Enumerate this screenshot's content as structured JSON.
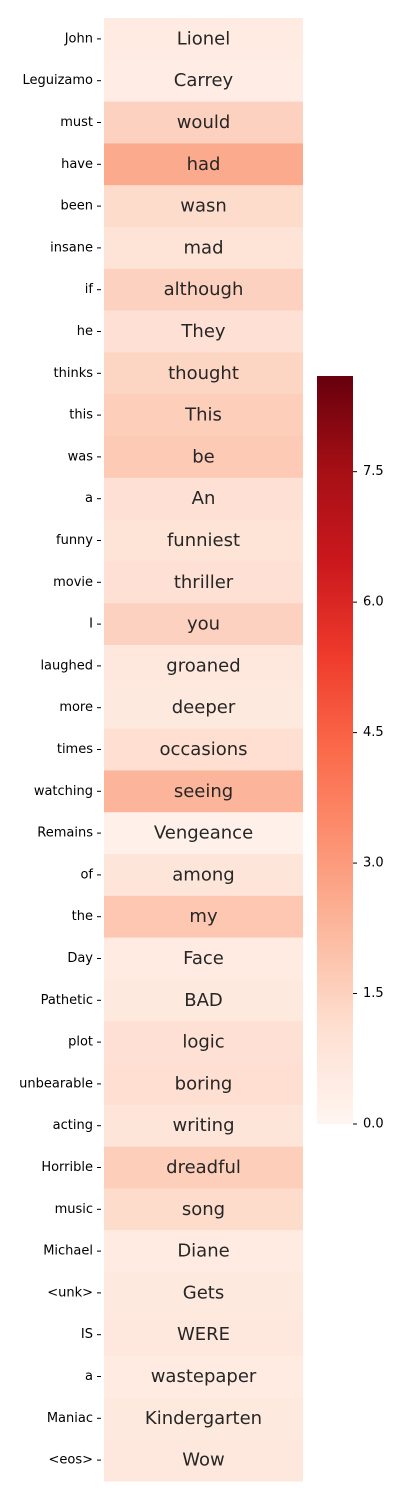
{
  "chart_data": {
    "type": "heatmap",
    "colormap": "Reds",
    "vmin": 0,
    "vmax": 8.6,
    "colorbar_ticks": [
      "0.0",
      "1.5",
      "3.0",
      "4.5",
      "6.0",
      "7.5"
    ],
    "rows": [
      {
        "label": "John",
        "cell": "Lionel",
        "value": 0.5
      },
      {
        "label": "Leguizamo",
        "cell": "Carrey",
        "value": 0.4
      },
      {
        "label": "must",
        "cell": "would",
        "value": 1.5
      },
      {
        "label": "have",
        "cell": "had",
        "value": 2.6
      },
      {
        "label": "been",
        "cell": "wasn",
        "value": 1.2
      },
      {
        "label": "insane",
        "cell": "mad",
        "value": 0.9
      },
      {
        "label": "if",
        "cell": "although",
        "value": 1.5
      },
      {
        "label": "he",
        "cell": "They",
        "value": 1.0
      },
      {
        "label": "thinks",
        "cell": "thought",
        "value": 1.4
      },
      {
        "label": "this",
        "cell": "This",
        "value": 1.6
      },
      {
        "label": "was",
        "cell": "be",
        "value": 1.7
      },
      {
        "label": "a",
        "cell": "An",
        "value": 1.0
      },
      {
        "label": "funny",
        "cell": "funniest",
        "value": 0.9
      },
      {
        "label": "movie",
        "cell": "thriller",
        "value": 1.0
      },
      {
        "label": "I",
        "cell": "you",
        "value": 1.5
      },
      {
        "label": "laughed",
        "cell": "groaned",
        "value": 0.7
      },
      {
        "label": "more",
        "cell": "deeper",
        "value": 0.6
      },
      {
        "label": "times",
        "cell": "occasions",
        "value": 1.1
      },
      {
        "label": "watching",
        "cell": "seeing",
        "value": 2.3
      },
      {
        "label": "Remains",
        "cell": "Vengeance",
        "value": 0.2
      },
      {
        "label": "of",
        "cell": "among",
        "value": 0.8
      },
      {
        "label": "the",
        "cell": "my",
        "value": 1.8
      },
      {
        "label": "Day",
        "cell": "Face",
        "value": 0.5
      },
      {
        "label": "Pathetic",
        "cell": "BAD",
        "value": 0.6
      },
      {
        "label": "plot",
        "cell": "logic",
        "value": 1.0
      },
      {
        "label": "unbearable",
        "cell": "boring",
        "value": 1.1
      },
      {
        "label": "acting",
        "cell": "writing",
        "value": 0.8
      },
      {
        "label": "Horrible",
        "cell": "dreadful",
        "value": 1.6
      },
      {
        "label": "music",
        "cell": "song",
        "value": 1.2
      },
      {
        "label": "Michael",
        "cell": "Diane",
        "value": 0.5
      },
      {
        "label": "<unk>",
        "cell": "Gets",
        "value": 0.6
      },
      {
        "label": "IS",
        "cell": "WERE",
        "value": 0.7
      },
      {
        "label": "a",
        "cell": "wastepaper",
        "value": 0.5
      },
      {
        "label": "Maniac",
        "cell": "Kindergarten",
        "value": 0.6
      },
      {
        "label": "<eos>",
        "cell": "Wow",
        "value": 0.7
      }
    ]
  }
}
